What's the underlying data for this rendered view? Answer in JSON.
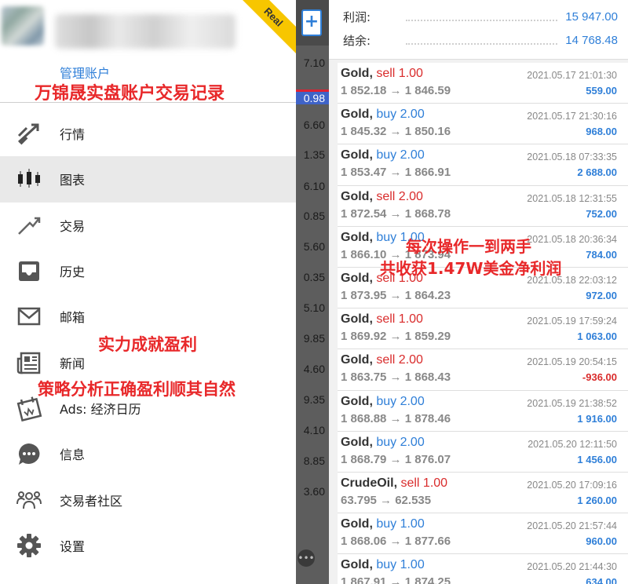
{
  "drawer": {
    "badge": "Real",
    "manage_link": "管理账户",
    "title_overlay": "万锦晟实盘账户交易记录",
    "menu": [
      {
        "label": "行情",
        "icon": "quotes-icon"
      },
      {
        "label": "图表",
        "icon": "candlestick-chart-icon"
      },
      {
        "label": "交易",
        "icon": "trade-icon"
      },
      {
        "label": "历史",
        "icon": "history-inbox-icon"
      },
      {
        "label": "邮箱",
        "icon": "mail-icon"
      },
      {
        "label": "新闻",
        "icon": "news-icon"
      },
      {
        "label": "Ads: 经济日历",
        "icon": "calendar-icon"
      },
      {
        "label": "信息",
        "icon": "chat-icon"
      },
      {
        "label": "交易者社区",
        "icon": "community-icon"
      },
      {
        "label": "设置",
        "icon": "gear-icon"
      }
    ],
    "overlay_strength": "实力成就盈利",
    "overlay_strategy": "策略分析正确盈利顺其自然"
  },
  "strip": {
    "numbers": [
      "7.10",
      "0.98",
      "6.60",
      "1.35",
      "6.10",
      "0.85",
      "5.60",
      "0.35",
      "5.10",
      "9.85",
      "4.60",
      "9.35",
      "4.10",
      "8.85",
      "3.60"
    ]
  },
  "summary": {
    "profit_label": "利润:",
    "profit_value": "15 947.00",
    "balance_label": "结余:",
    "balance_value": "14 768.48"
  },
  "orders": [
    {
      "symbol": "Gold,",
      "side": "sell",
      "side_text": "sell 1.00",
      "prices": "1 852.18 → 1 846.59",
      "time": "2021.05.17 21:01:30",
      "profit": "559.00"
    },
    {
      "symbol": "Gold,",
      "side": "buy",
      "side_text": "buy 2.00",
      "prices": "1 845.32 → 1 850.16",
      "time": "2021.05.17 21:30:16",
      "profit": "968.00"
    },
    {
      "symbol": "Gold,",
      "side": "buy",
      "side_text": "buy 2.00",
      "prices": "1 853.47 → 1 866.91",
      "time": "2021.05.18 07:33:35",
      "profit": "2 688.00"
    },
    {
      "symbol": "Gold,",
      "side": "sell",
      "side_text": "sell 2.00",
      "prices": "1 872.54 → 1 868.78",
      "time": "2021.05.18 12:31:55",
      "profit": "752.00"
    },
    {
      "symbol": "Gold,",
      "side": "buy",
      "side_text": "buy 1.00",
      "prices": "1 866.10 → 1 873.94",
      "time": "2021.05.18 20:36:34",
      "profit": "784.00"
    },
    {
      "symbol": "Gold,",
      "side": "sell",
      "side_text": "sell 1.00",
      "prices": "1 873.95 → 1 864.23",
      "time": "2021.05.18 22:03:12",
      "profit": "972.00"
    },
    {
      "symbol": "Gold,",
      "side": "sell",
      "side_text": "sell 1.00",
      "prices": "1 869.92 → 1 859.29",
      "time": "2021.05.19 17:59:24",
      "profit": "1 063.00"
    },
    {
      "symbol": "Gold,",
      "side": "sell",
      "side_text": "sell 2.00",
      "prices": "1 863.75 → 1 868.43",
      "time": "2021.05.19 20:54:15",
      "profit": "-936.00"
    },
    {
      "symbol": "Gold,",
      "side": "buy",
      "side_text": "buy 2.00",
      "prices": "1 868.88 → 1 878.46",
      "time": "2021.05.19 21:38:52",
      "profit": "1 916.00"
    },
    {
      "symbol": "Gold,",
      "side": "buy",
      "side_text": "buy 2.00",
      "prices": "1 868.79 → 1 876.07",
      "time": "2021.05.20 12:11:50",
      "profit": "1 456.00"
    },
    {
      "symbol": "CrudeOil,",
      "side": "sell",
      "side_text": "sell 1.00",
      "prices": "63.795 → 62.535",
      "time": "2021.05.20 17:09:16",
      "profit": "1 260.00"
    },
    {
      "symbol": "Gold,",
      "side": "buy",
      "side_text": "buy 1.00",
      "prices": "1 868.06 → 1 877.66",
      "time": "2021.05.20 21:57:44",
      "profit": "960.00"
    },
    {
      "symbol": "Gold,",
      "side": "buy",
      "side_text": "buy 1.00",
      "prices": "1 867.91 → 1 874.25",
      "time": "2021.05.20 21:44:30",
      "profit": "634.00"
    }
  ],
  "overlays": {
    "ops": "每次操作一到两手",
    "net": "共收获1.47W美金净利润"
  }
}
